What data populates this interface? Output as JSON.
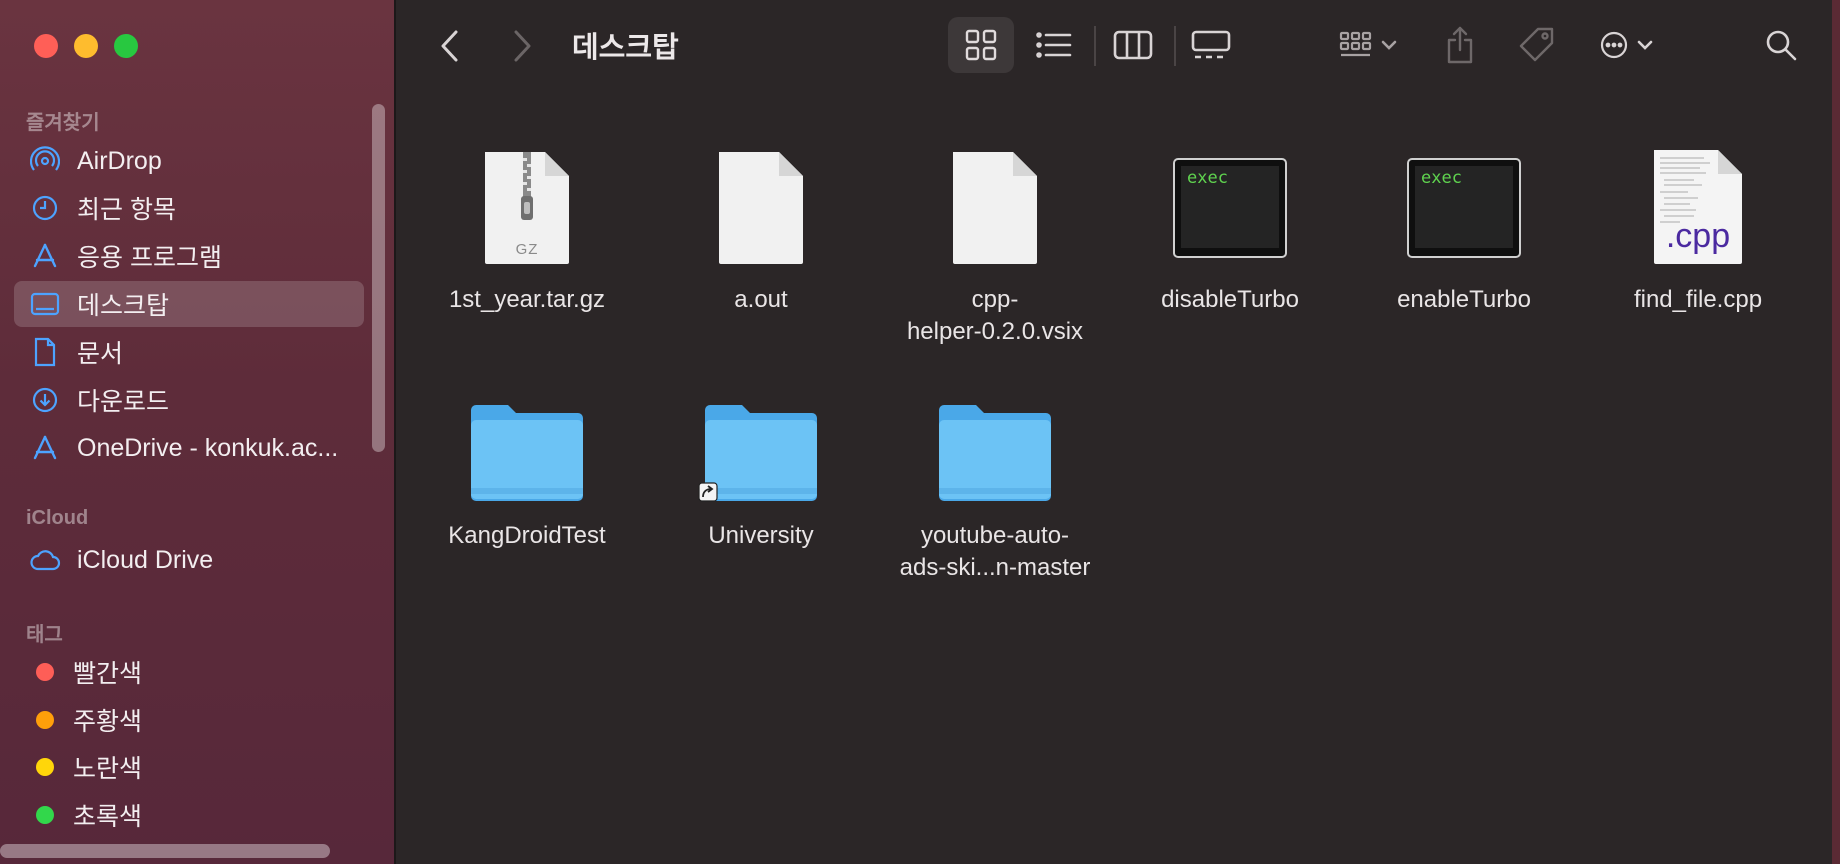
{
  "window": {
    "title": "데스크탑"
  },
  "sidebar": {
    "favorites_header": "즐겨찾기",
    "favorites": [
      {
        "label": "AirDrop",
        "icon": "airdrop-icon"
      },
      {
        "label": "최근 항목",
        "icon": "clock-icon"
      },
      {
        "label": "응용 프로그램",
        "icon": "applications-icon"
      },
      {
        "label": "데스크탑",
        "icon": "desktop-icon",
        "selected": true
      },
      {
        "label": "문서",
        "icon": "document-icon"
      },
      {
        "label": "다운로드",
        "icon": "download-icon"
      },
      {
        "label": "OneDrive - konkuk.ac...",
        "icon": "onedrive-icon"
      }
    ],
    "icloud_header": "iCloud",
    "icloud": [
      {
        "label": "iCloud Drive",
        "icon": "cloud-icon"
      }
    ],
    "tags_header": "태그",
    "tags": [
      {
        "label": "빨간색",
        "color": "#fe5e57"
      },
      {
        "label": "주황색",
        "color": "#ff9f0a"
      },
      {
        "label": "노란색",
        "color": "#ffd60a"
      },
      {
        "label": "초록색",
        "color": "#32d74b"
      }
    ]
  },
  "files": [
    {
      "name": "1st_year.tar.gz",
      "kind": "archive",
      "badge": "GZ"
    },
    {
      "name": "a.out",
      "kind": "blank"
    },
    {
      "name": "cpp-\nhelper-0.2.0.vsix",
      "kind": "blank"
    },
    {
      "name": "disableTurbo",
      "kind": "exec",
      "badge": "exec"
    },
    {
      "name": "enableTurbo",
      "kind": "exec",
      "badge": "exec"
    },
    {
      "name": "find_file.cpp",
      "kind": "cpp",
      "badge": ".cpp"
    },
    {
      "name": "KangDroidTest",
      "kind": "folder"
    },
    {
      "name": "University",
      "kind": "folder-alias"
    },
    {
      "name": "youtube-auto-\nads-ski...n-master",
      "kind": "folder"
    }
  ],
  "colors": {
    "folder": "#6cc3f5",
    "accent": "#3d8ef5",
    "sidebar_icon": "#4da3ff"
  }
}
